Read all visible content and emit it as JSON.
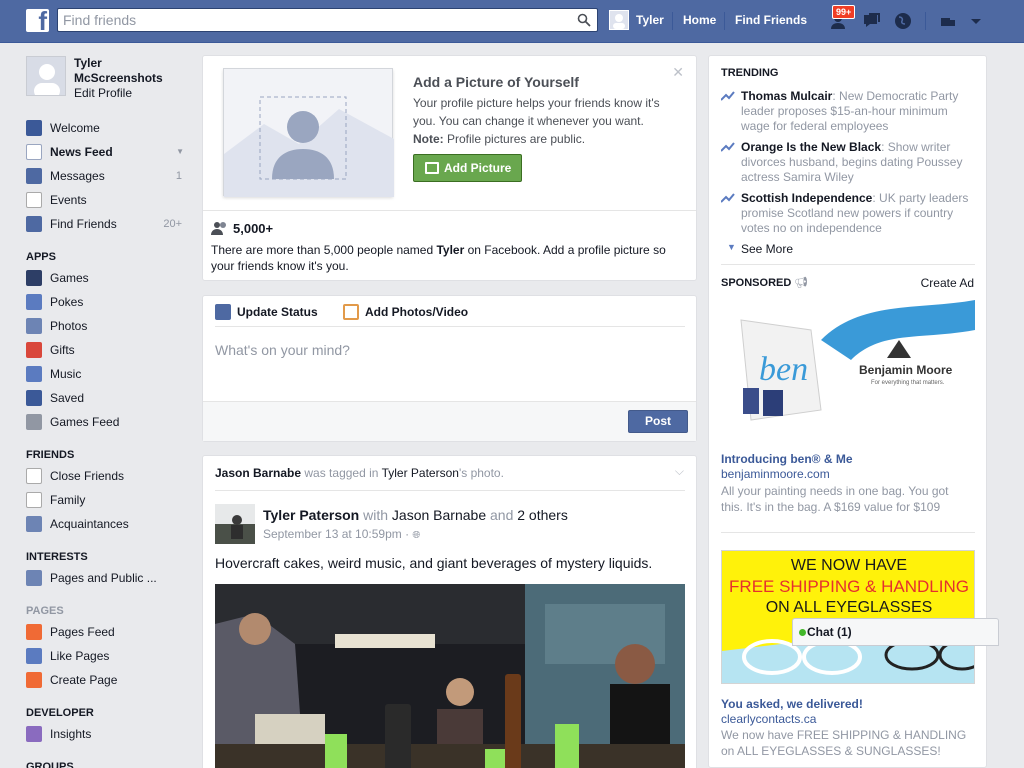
{
  "header": {
    "logo_letter": "f",
    "search_placeholder": "Find friends",
    "user_name": "Tyler",
    "home_label": "Home",
    "find_friends_label": "Find Friends",
    "notification_badge": "99+"
  },
  "sidebar": {
    "profile_name": "Tyler McScreenshots",
    "edit_profile": "Edit Profile",
    "main_items": [
      {
        "label": "Welcome",
        "count": ""
      },
      {
        "label": "News Feed",
        "count": ""
      },
      {
        "label": "Messages",
        "count": "1"
      },
      {
        "label": "Events",
        "count": ""
      },
      {
        "label": "Find Friends",
        "count": "20+"
      }
    ],
    "apps_heading": "APPS",
    "apps": [
      "Games",
      "Pokes",
      "Photos",
      "Gifts",
      "Music",
      "Saved",
      "Games Feed"
    ],
    "friends_heading": "FRIENDS",
    "friends": [
      "Close Friends",
      "Family",
      "Acquaintances"
    ],
    "interests_heading": "INTERESTS",
    "interests": [
      "Pages and Public ..."
    ],
    "pages_heading": "PAGES",
    "pages": [
      "Pages Feed",
      "Like Pages",
      "Create Page"
    ],
    "developer_heading": "DEVELOPER",
    "developer": [
      "Insights"
    ],
    "groups_heading": "GROUPS"
  },
  "profile_prompt": {
    "title": "Add a Picture of Yourself",
    "desc": "Your profile picture helps your friends know it's you. You can change it whenever you want.",
    "note_label": "Note:",
    "note_text": " Profile pictures are public.",
    "button": "Add Picture",
    "count": "5,000+",
    "people_desc_1": "There are more than 5,000 people named ",
    "people_desc_name": "Tyler",
    "people_desc_2": " on Facebook. Add a profile picture so your friends know it's you."
  },
  "composer": {
    "tab_status": "Update Status",
    "tab_photos": "Add Photos/Video",
    "placeholder": "What's on your mind?",
    "post_button": "Post"
  },
  "story": {
    "actor": "Jason Barnabe",
    "verb": " was tagged in ",
    "owner": "Tyler Paterson",
    "suffix": "'s photo.",
    "author": "Tyler Paterson",
    "with": " with ",
    "tagged": "Jason Barnabe",
    "and": " and ",
    "others": "2 others",
    "time": "September 13 at 10:59pm · ",
    "text": "Hovercraft cakes, weird music, and giant beverages of mystery liquids."
  },
  "trending": {
    "heading": "TRENDING",
    "items": [
      {
        "topic": "Thomas Mulcair",
        "desc": ": New Democratic Party leader proposes $15-an-hour minimum wage for federal employees"
      },
      {
        "topic": "Orange Is the New Black",
        "desc": ": Show writer divorces husband, begins dating Poussey actress Samira Wiley"
      },
      {
        "topic": "Scottish Independence",
        "desc": ": UK party leaders promise Scotland new powers if country votes no on independence"
      }
    ],
    "see_more": "See More"
  },
  "sponsored": {
    "heading": "SPONSORED",
    "create_ad": "Create Ad",
    "ad1": {
      "brand": "Benjamin Moore",
      "brand_tag": "For everything that matters.",
      "bag_text": "ben",
      "title": "Introducing ben® & Me",
      "url": "benjaminmoore.com",
      "desc": "All your painting needs in one bag. You got this. It's in the bag. A $169 value for $109"
    },
    "ad2": {
      "line1": "WE NOW HAVE",
      "line2": "FREE SHIPPING & HANDLING",
      "line3": "ON ALL EYEGLASSES",
      "title": "You asked, we delivered!",
      "url": "clearlycontacts.ca",
      "desc": "We now have FREE SHIPPING & HANDLING on ALL EYEGLASSES & SUNGLASSES!"
    }
  },
  "chat": {
    "label": "Chat (1)"
  },
  "colors": {
    "brand": "#4e69a2",
    "accent_green": "#69a74e",
    "link": "#3b5998"
  }
}
